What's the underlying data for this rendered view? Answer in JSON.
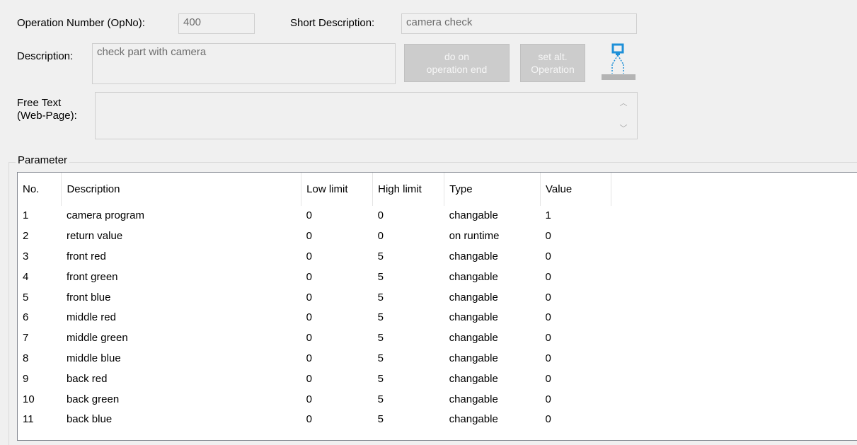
{
  "header": {
    "opno_label": "Operation Number (OpNo):",
    "opno_value": "400",
    "short_desc_label": "Short Description:",
    "short_desc_value": "camera check",
    "description_label": "Description:",
    "description_value": "check part with camera",
    "free_text_label_line1": "Free Text",
    "free_text_label_line2": "(Web-Page):",
    "free_text_value": ""
  },
  "buttons": {
    "do_on_end_line1": "do on",
    "do_on_end_line2": "operation end",
    "set_alt_line1": "set alt.",
    "set_alt_line2": "Operation"
  },
  "icons": {
    "camera_station": "camera-station-icon",
    "scroll_up": "chevron-up-icon",
    "scroll_down": "chevron-down-icon"
  },
  "parameter": {
    "group_title": "Parameter",
    "columns": [
      "No.",
      "Description",
      "Low limit",
      "High limit",
      "Type",
      "Value"
    ],
    "rows": [
      [
        "1",
        "camera program",
        "0",
        "0",
        "changable",
        "1"
      ],
      [
        "2",
        "return value",
        "0",
        "0",
        "on runtime",
        "0"
      ],
      [
        "3",
        "front red",
        "0",
        "5",
        "changable",
        "0"
      ],
      [
        "4",
        "front green",
        "0",
        "5",
        "changable",
        "0"
      ],
      [
        "5",
        "front blue",
        "0",
        "5",
        "changable",
        "0"
      ],
      [
        "6",
        "middle red",
        "0",
        "5",
        "changable",
        "0"
      ],
      [
        "7",
        "middle green",
        "0",
        "5",
        "changable",
        "0"
      ],
      [
        "8",
        "middle blue",
        "0",
        "5",
        "changable",
        "0"
      ],
      [
        "9",
        "back red",
        "0",
        "5",
        "changable",
        "0"
      ],
      [
        "10",
        "back green",
        "0",
        "5",
        "changable",
        "0"
      ],
      [
        "11",
        "back blue",
        "0",
        "5",
        "changable",
        "0"
      ]
    ]
  },
  "colors": {
    "window_bg": "#f0f0f0",
    "disabled_text": "#6d6d6d",
    "icon_blue": "#1e90d8"
  }
}
